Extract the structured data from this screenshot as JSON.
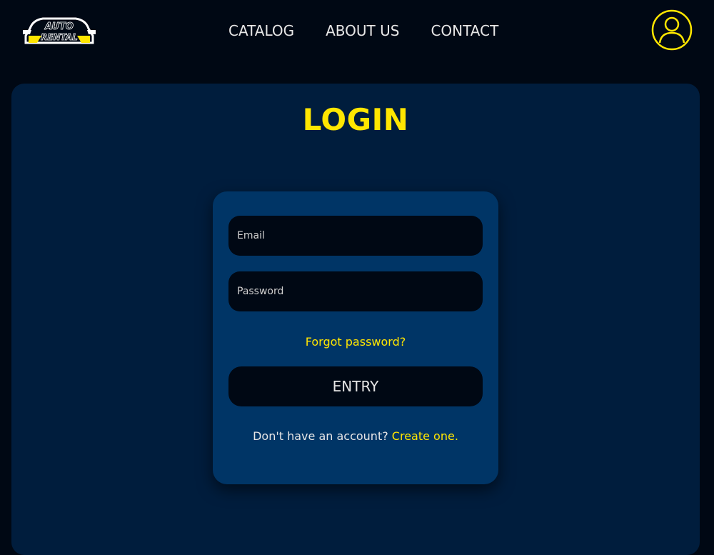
{
  "brand": {
    "logo_top": "AUTO",
    "logo_bottom": "RENTAL",
    "accent_color": "#ffe600"
  },
  "nav": {
    "items": [
      {
        "label": "CATALOG"
      },
      {
        "label": "ABOUT US"
      },
      {
        "label": "CONTACT"
      }
    ]
  },
  "header": {
    "profile_icon": "user-circle-icon"
  },
  "page": {
    "title": "LOGIN"
  },
  "login_form": {
    "email_placeholder": "Email",
    "email_value": "",
    "password_placeholder": "Password",
    "password_value": "",
    "forgot_label": "Forgot password?",
    "submit_label": "ENTRY",
    "signup_prompt": "Don't have an account? ",
    "signup_link": "Create one."
  },
  "colors": {
    "background": "#000814",
    "panel": "#001d3d",
    "card": "#003566",
    "accent": "#ffe600"
  }
}
